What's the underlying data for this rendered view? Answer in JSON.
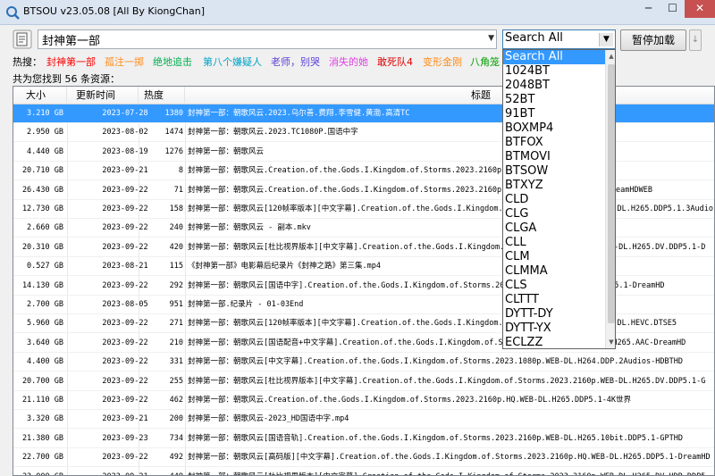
{
  "window": {
    "title": "BTSOU v23.05.08 [All By KiongChan]",
    "minimize": "─",
    "maximize": "☐",
    "close": "✕"
  },
  "toolbar": {
    "search_value": "封神第一部",
    "source_value": "Search All",
    "pause_label": "暂停加载",
    "arrow_label": "↓"
  },
  "hot": {
    "label": "热搜：",
    "items": [
      {
        "text": "封神第一部",
        "color": "#ff0000"
      },
      {
        "text": "孤注一掷",
        "color": "#ff8c1a"
      },
      {
        "text": "绝地追击",
        "color": "#00b050"
      },
      {
        "text": "第八个嫌疑人",
        "color": "#00a5c8"
      },
      {
        "text": "老师，别哭",
        "color": "#5b3fd6"
      },
      {
        "text": "消失的她",
        "color": "#e040e0"
      },
      {
        "text": "敢死队4",
        "color": "#e00000"
      },
      {
        "text": "变形金刚",
        "color": "#ff8c1a"
      },
      {
        "text": "八角笼",
        "color": "#00a000"
      }
    ]
  },
  "count": {
    "text": "共为您找到 56 条资源："
  },
  "table": {
    "headers": {
      "size": "大小",
      "date": "更新时间",
      "heat": "热度",
      "title": "标题"
    },
    "rows": [
      {
        "size": "3.210 GB",
        "date": "2023-07-28",
        "heat": "1380",
        "title": "封神第一部：朝歌风云.2023.乌尔善.费翔.李雪健.黄渤.高清TC"
      },
      {
        "size": "2.950 GB",
        "date": "2023-08-02",
        "heat": "1474",
        "title": "封神第一部：朝歌风云.2023.TC1080P.国语中字"
      },
      {
        "size": "4.440 GB",
        "date": "2023-08-19",
        "heat": "1276",
        "title": "封神第一部：朝歌风云"
      },
      {
        "size": "20.710 GB",
        "date": "2023-09-21",
        "heat": "8",
        "title": "封神第一部：朝歌风云.Creation.of.the.Gods.I.Kingdom.of.Storms.2023.2160p.WEB-DL.H265"
      },
      {
        "size": "26.430 GB",
        "date": "2023-09-22",
        "heat": "71",
        "title": "封神第一部：朝歌风云.Creation.of.the.Gods.I.Kingdom.of.Storms.2023.2160p.HQ.WEB-DL.H265.DDP5.1-DreamHDWEB"
      },
      {
        "size": "12.730 GB",
        "date": "2023-09-22",
        "heat": "158",
        "title": "封神第一部：朝歌风云[120帧率版本][中文字幕].Creation.of.the.Gods.I.Kingdom.of.Storms.2023.2160p.WEB-DL.H265.DDP5.1.3Audios-HDBT"
      },
      {
        "size": "2.660 GB",
        "date": "2023-09-22",
        "heat": "240",
        "title": "封神第一部：朝歌风云  - 副本.mkv"
      },
      {
        "size": "20.310 GB",
        "date": "2023-09-22",
        "heat": "420",
        "title": "封神第一部：朝歌风云[杜比视界版本][中文字幕].Creation.of.the.Gods.I.Kingdom.of.Storms.2023.2160p.WEB-DL.H265.DV.DDP5.1-D"
      },
      {
        "size": "0.527 GB",
        "date": "2023-08-21",
        "heat": "115",
        "title": "《封神第一部》电影幕后纪录片《封神之路》第三集.mp4"
      },
      {
        "size": "14.130 GB",
        "date": "2023-09-22",
        "heat": "292",
        "title": "封神第一部：朝歌风云[国语中字].Creation.of.the.Gods.I.Kingdom.of.Storms.2023.2160p.WEB-DL.H265.DDP5.1-DreamHD"
      },
      {
        "size": "2.700 GB",
        "date": "2023-08-05",
        "heat": "951",
        "title": "封神第一部.纪录片 - 01-03End"
      },
      {
        "size": "5.960 GB",
        "date": "2023-09-22",
        "heat": "271",
        "title": "封神第一部：朝歌风云[120帧率版本][中文字幕].Creation.of.the.Gods.I.Kingdom.of.Storms.2023.2160p.WEB-DL.HEVC.DTSE5"
      },
      {
        "size": "3.640 GB",
        "date": "2023-09-22",
        "heat": "210",
        "title": "封神第一部：朝歌风云[国语配音+中文字幕].Creation.of.the.Gods.I.Kingdom.of.Storms.2023.2160p.WEB-DL.H265.AAC-DreamHD"
      },
      {
        "size": "4.400 GB",
        "date": "2023-09-22",
        "heat": "331",
        "title": "封神第一部：朝歌风云[中文字幕].Creation.of.the.Gods.I.Kingdom.of.Storms.2023.1080p.WEB-DL.H264.DDP.2Audios-HDBTHD"
      },
      {
        "size": "20.700 GB",
        "date": "2023-09-22",
        "heat": "255",
        "title": "封神第一部：朝歌风云[杜比视界版本][中文字幕].Creation.of.the.Gods.I.Kingdom.of.Storms.2023.2160p.WEB-DL.H265.DV.DDP5.1-G"
      },
      {
        "size": "21.110 GB",
        "date": "2023-09-22",
        "heat": "462",
        "title": "封神第一部：朝歌风云.Creation.of.the.Gods.I.Kingdom.of.Storms.2023.2160p.HQ.WEB-DL.H265.DDP5.1-4K世界"
      },
      {
        "size": "3.320 GB",
        "date": "2023-09-21",
        "heat": "200",
        "title": "封神第一部：朝歌风云-2023_HD国语中字.mp4"
      },
      {
        "size": "21.380 GB",
        "date": "2023-09-23",
        "heat": "734",
        "title": "封神第一部：朝歌风云[国语音轨].Creation.of.the.Gods.I.Kingdom.of.Storms.2023.2160p.WEB-DL.H265.10bit.DDP5.1-GPTHD"
      },
      {
        "size": "22.700 GB",
        "date": "2023-09-22",
        "heat": "492",
        "title": "封神第一部：朝歌风云[高码版][中文字幕].Creation.of.the.Gods.I.Kingdom.of.Storms.2023.2160p.HQ.WEB-DL.H265.DDP5.1-DreamHD"
      },
      {
        "size": "23.000 GB",
        "date": "2023-09-21",
        "heat": "449",
        "title": "封神第一部：朝歌风云[杜比视界版本][中文字幕].Creation.of.the.Gods.I.Kingdom.of.Storms.2023.2160p.WEB-DL.H265.DV.HDR.DDP5"
      }
    ]
  },
  "dropdown": {
    "options": [
      "Search All",
      "1024BT",
      "2048BT",
      "52BT",
      "91BT",
      "BOXMP4",
      "BTFOX",
      "BTMOVI",
      "BTSOW",
      "BTXYZ",
      "CLD",
      "CLG",
      "CLGA",
      "CLL",
      "CLM",
      "CLMMA",
      "CLS",
      "CLTTT",
      "DYTT-DY",
      "DYTT-YX",
      "ECLZZ"
    ],
    "selected_index": 0
  },
  "colors": {
    "selection": "#3399ff",
    "titlebar": "#dbe5f1",
    "close_button": "#c75050"
  }
}
